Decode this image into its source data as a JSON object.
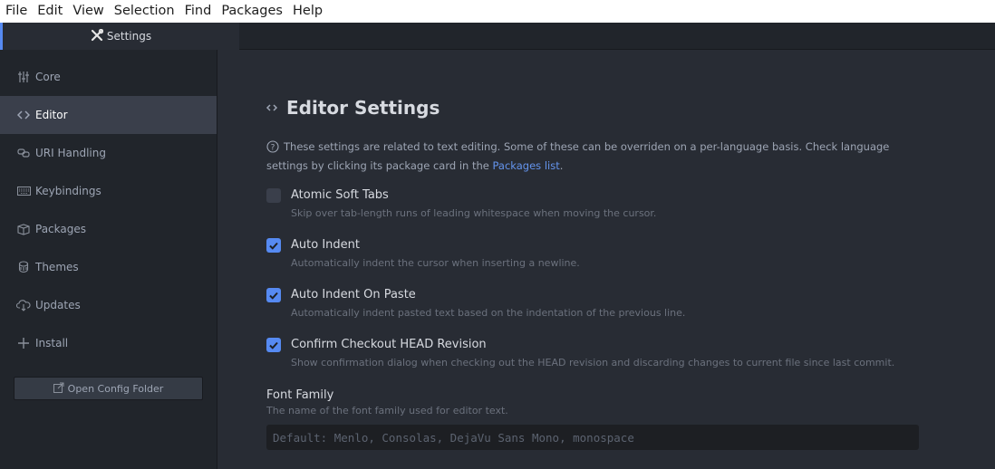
{
  "menubar": {
    "items": [
      "File",
      "Edit",
      "View",
      "Selection",
      "Find",
      "Packages",
      "Help"
    ]
  },
  "tab": {
    "label": "Settings",
    "icon": "tools-icon"
  },
  "sidebar": {
    "items": [
      {
        "label": "Core",
        "icon": "sliders-icon",
        "active": false
      },
      {
        "label": "Editor",
        "icon": "code-icon",
        "active": true
      },
      {
        "label": "URI Handling",
        "icon": "link-icon",
        "active": false
      },
      {
        "label": "Keybindings",
        "icon": "keyboard-icon",
        "active": false
      },
      {
        "label": "Packages",
        "icon": "package-icon",
        "active": false
      },
      {
        "label": "Themes",
        "icon": "paintcan-icon",
        "active": false
      },
      {
        "label": "Updates",
        "icon": "cloud-download-icon",
        "active": false
      },
      {
        "label": "Install",
        "icon": "plus-icon",
        "active": false
      }
    ],
    "open_config_label": "Open Config Folder"
  },
  "main": {
    "title": "Editor Settings",
    "description_prefix": "These settings are related to text editing. Some of these can be overriden on a per-language basis. Check language settings by clicking its package card in the ",
    "description_link": "Packages list",
    "description_suffix": ".",
    "settings": [
      {
        "label": "Atomic Soft Tabs",
        "description": "Skip over tab-length runs of leading whitespace when moving the cursor.",
        "checked": false
      },
      {
        "label": "Auto Indent",
        "description": "Automatically indent the cursor when inserting a newline.",
        "checked": true
      },
      {
        "label": "Auto Indent On Paste",
        "description": "Automatically indent pasted text based on the indentation of the previous line.",
        "checked": true
      },
      {
        "label": "Confirm Checkout HEAD Revision",
        "description": "Show confirmation dialog when checking out the HEAD revision and discarding changes to current file since last commit.",
        "checked": true
      }
    ],
    "font_family": {
      "label": "Font Family",
      "description": "The name of the font family used for editor text.",
      "value": "",
      "placeholder": "Default: Menlo, Consolas, DejaVu Sans Mono, monospace"
    }
  },
  "colors": {
    "accent": "#568af2",
    "link": "#6494ed",
    "background": "#282c34",
    "sidebar": "#21252b"
  }
}
